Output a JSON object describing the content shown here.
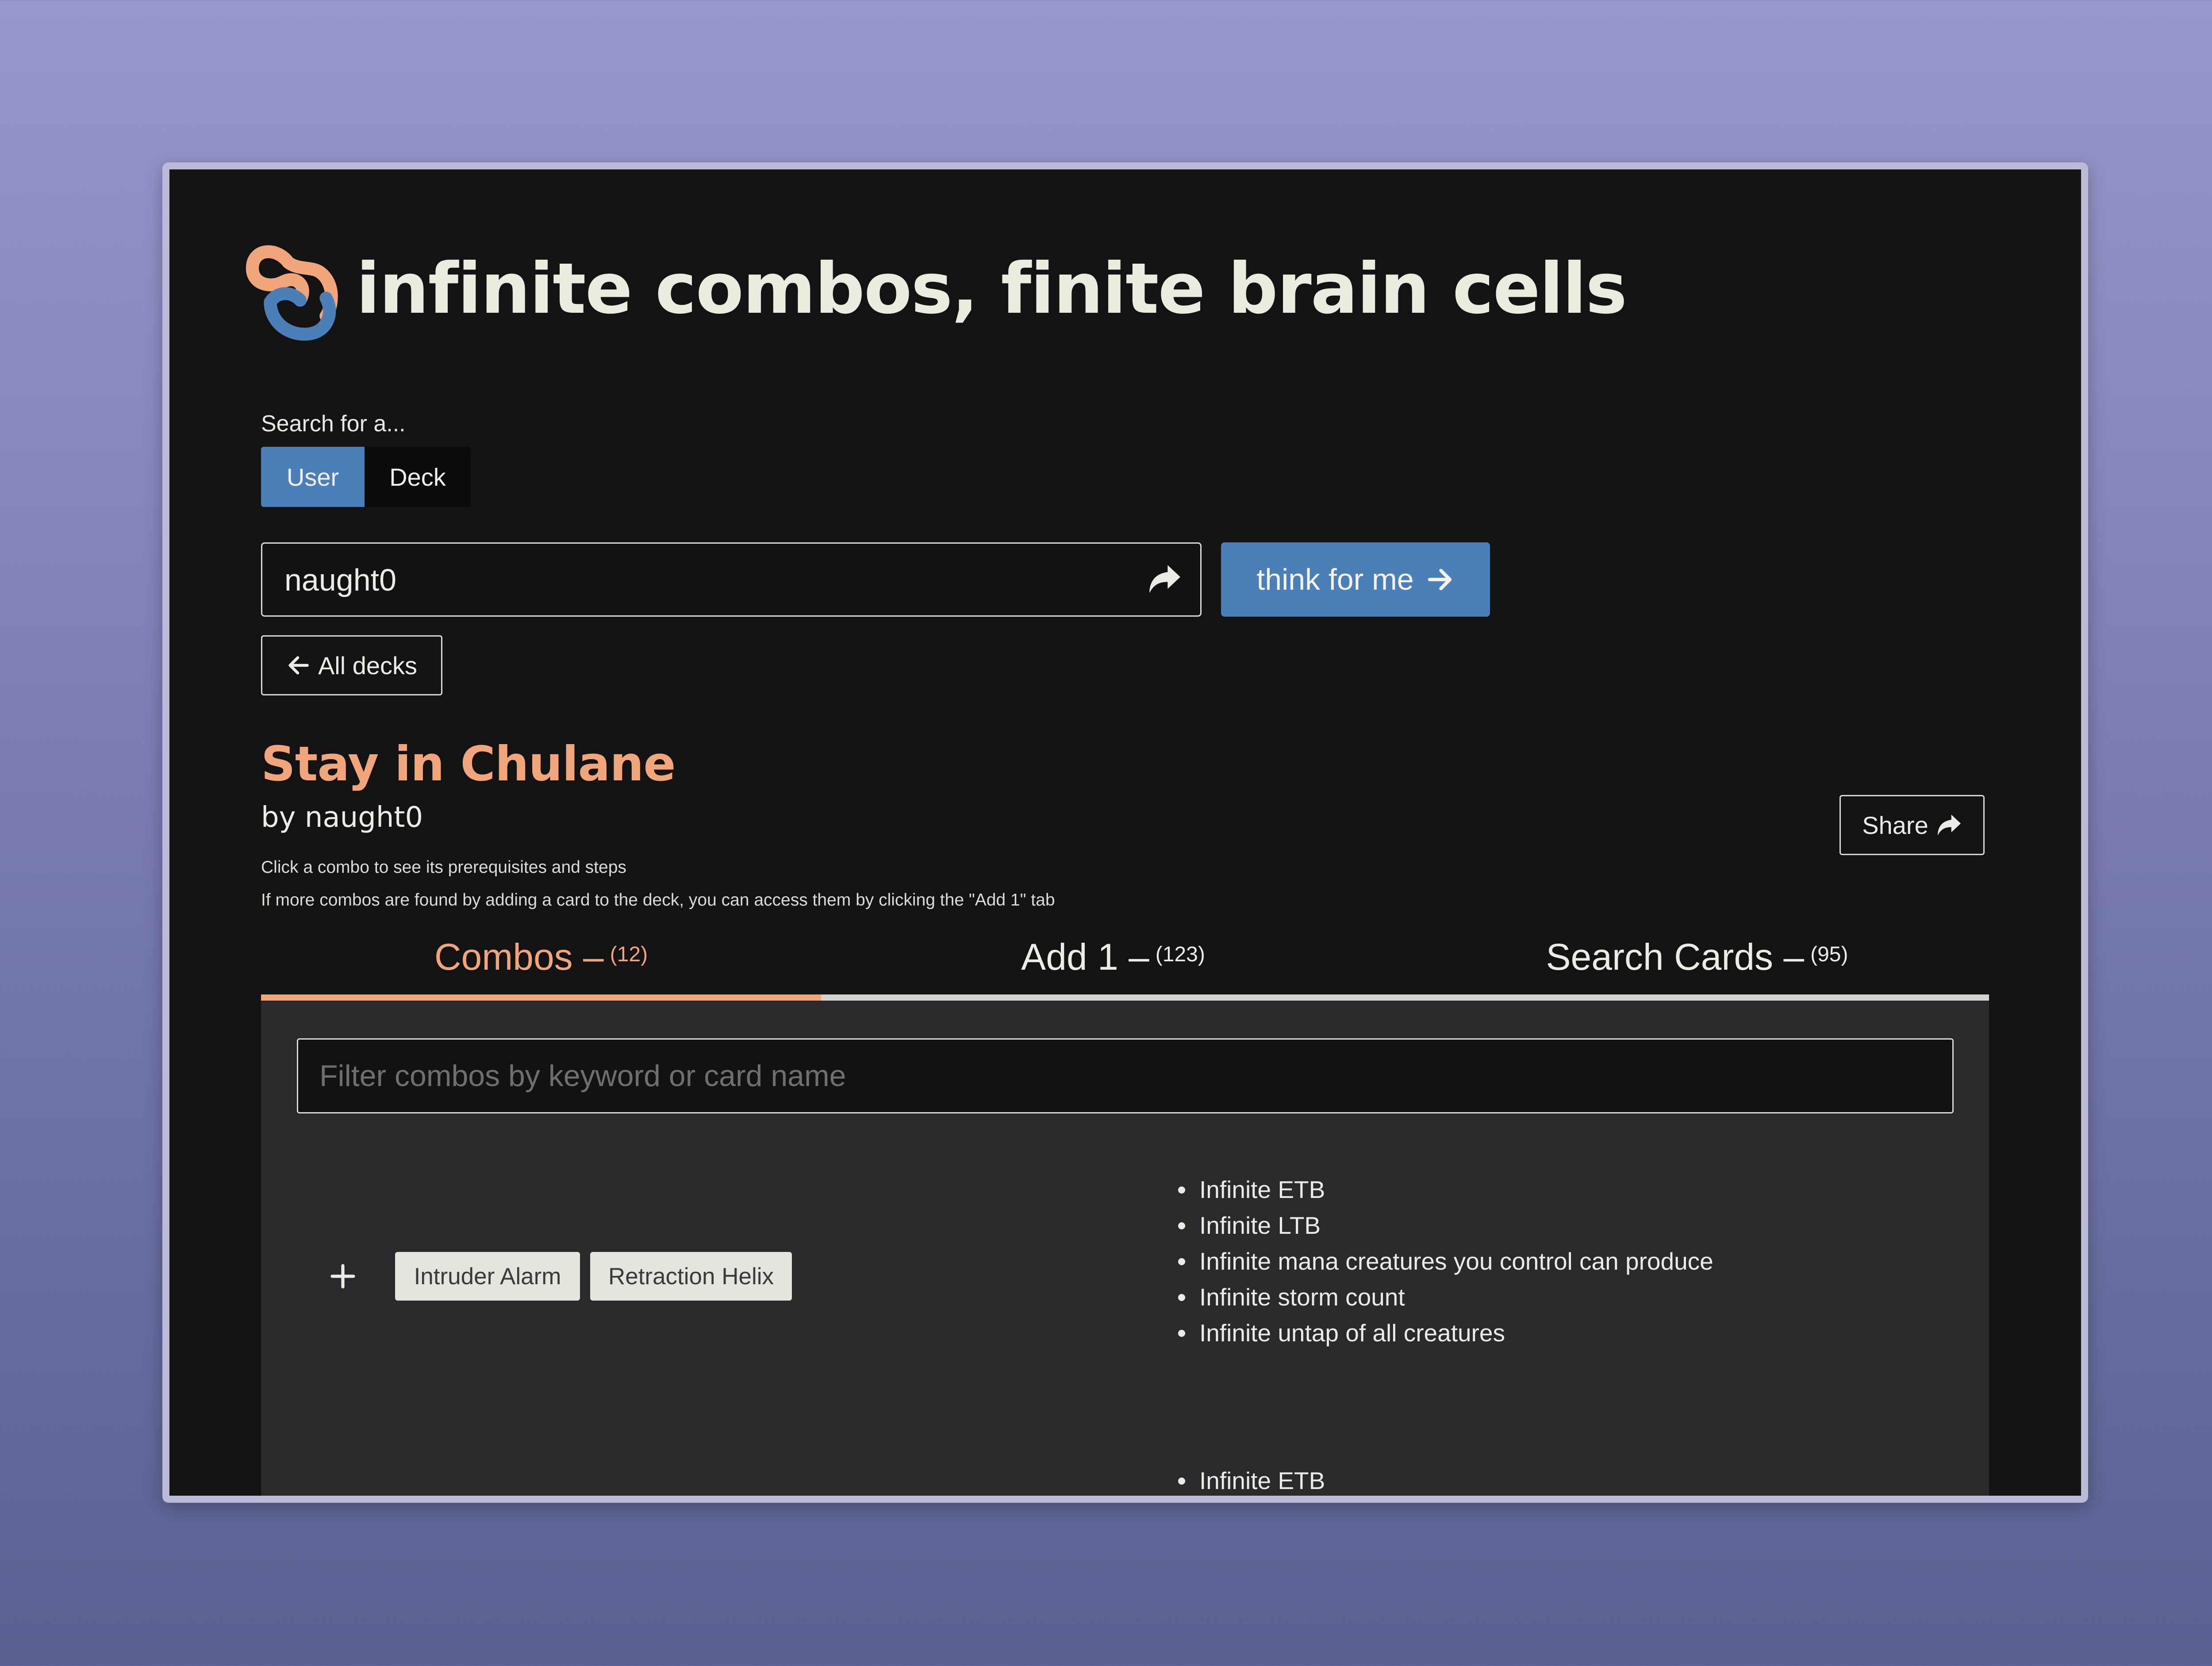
{
  "header": {
    "title": "infinite combos, finite brain cells"
  },
  "search": {
    "label": "Search for a...",
    "modes": [
      {
        "label": "User",
        "selected": true
      },
      {
        "label": "Deck",
        "selected": false
      }
    ],
    "value": "naught0",
    "submit_label": "think for me"
  },
  "nav": {
    "all_decks_label": "All decks"
  },
  "deck": {
    "title": "Stay in Chulane",
    "author": "by naught0",
    "share_label": "Share",
    "hint_1": "Click a combo to see its prerequisites and steps",
    "hint_2": "If more combos are found by adding a card to the deck, you can access them by clicking the \"Add 1\" tab"
  },
  "tabs": [
    {
      "label": "Combos –",
      "count": "(12)",
      "active": true
    },
    {
      "label": "Add 1 –",
      "count": "(123)",
      "active": false
    },
    {
      "label": "Search Cards –",
      "count": "(95)",
      "active": false
    }
  ],
  "filter": {
    "placeholder": "Filter combos by keyword or card name"
  },
  "combos": [
    {
      "cards": [
        "Intruder Alarm",
        "Retraction Helix"
      ],
      "results": [
        "Infinite ETB",
        "Infinite LTB",
        "Infinite mana creatures you control can produce",
        "Infinite storm count",
        "Infinite untap of all creatures"
      ]
    },
    {
      "cards": [],
      "results": [
        "Infinite ETB"
      ]
    }
  ],
  "colors": {
    "accent_orange": "#f0a67a",
    "accent_blue": "#4a7fb8",
    "background": "#141314",
    "panel": "#2a292b"
  }
}
